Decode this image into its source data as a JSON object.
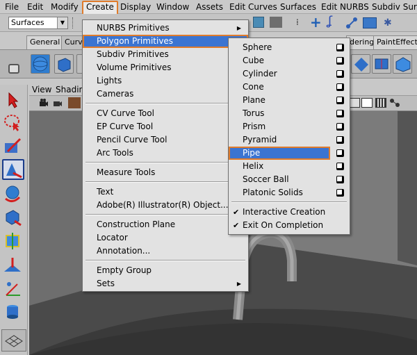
{
  "menubar": [
    "File",
    "Edit",
    "Modify",
    "Create",
    "Display",
    "Window",
    "Assets",
    "Edit Curves",
    "Surfaces",
    "Edit NURBS",
    "Subdiv Surfa"
  ],
  "mode_select": "Surfaces",
  "shelf_tabs": {
    "general": "General",
    "curves": "Curve",
    "rendering": "dering",
    "painteffects": "PaintEffects"
  },
  "viewport_menu": {
    "view": "View",
    "shading": "Shadin"
  },
  "create_menu": {
    "items": [
      "NURBS Primitives",
      "Polygon Primitives",
      "Subdiv Primitives",
      "Volume Primitives",
      "Lights",
      "Cameras",
      "CV Curve Tool",
      "EP Curve Tool",
      "Pencil Curve Tool",
      "Arc Tools",
      "Measure Tools",
      "Text",
      "Adobe(R) Illustrator(R) Object...",
      "Construction Plane",
      "Locator",
      "Annotation...",
      "Empty Group",
      "Sets"
    ]
  },
  "polygon_menu": {
    "items": [
      "Sphere",
      "Cube",
      "Cylinder",
      "Cone",
      "Plane",
      "Torus",
      "Prism",
      "Pyramid",
      "Pipe",
      "Helix",
      "Soccer Ball",
      "Platonic Solids"
    ],
    "toggles": [
      "Interactive Creation",
      "Exit On Completion"
    ]
  },
  "colors": {
    "highlight": "#3b74d1",
    "focus_outline": "#e07b2a"
  }
}
